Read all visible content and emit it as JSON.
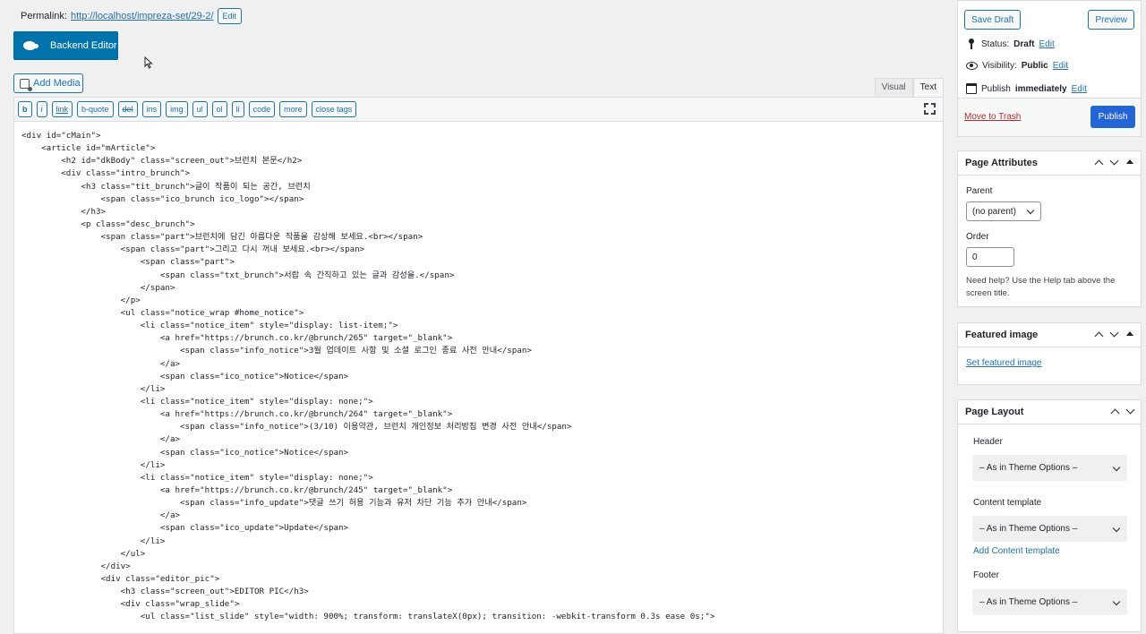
{
  "permalink": {
    "label": "Permalink:",
    "url": "http://localhost/impreza-set/29-2/",
    "edit_label": "Edit"
  },
  "backend_editor": {
    "label": "Backend Editor"
  },
  "add_media": {
    "label": "Add Media"
  },
  "editor_tabs": [
    {
      "label": "Visual",
      "active": false
    },
    {
      "label": "Text",
      "active": true
    }
  ],
  "quicktags": [
    "b",
    "i",
    "link",
    "b-quote",
    "del",
    "ins",
    "img",
    "ul",
    "ol",
    "li",
    "code",
    "more",
    "close tags"
  ],
  "code_lines": [
    "<div id=\"cMain\">",
    "    <article id=\"mArticle\">",
    "        <h2 id=\"dkBody\" class=\"screen_out\">브런치 본문</h2>",
    "        <div class=\"intro_brunch\">",
    "            <h3 class=\"tit_brunch\">글이 작품이 되는 공간, 브런치",
    "                <span class=\"ico_brunch ico_logo\"></span>",
    "            </h3>",
    "            <p class=\"desc_brunch\">",
    "                <span class=\"part\">브런치에 담긴 아름다운 작품을 감상해 보세요.<br></span>",
    "                    <span class=\"part\">그리고 다시 꺼내 보세요.<br></span>",
    "                        <span class=\"part\">",
    "                            <span class=\"txt_brunch\">서랍 속 간직하고 있는 글과 감성을.</span>",
    "                        </span>",
    "                    </p>",
    "                    <ul class=\"notice_wrap #home_notice\">",
    "                        <li class=\"notice_item\" style=\"display: list-item;\">",
    "                            <a href=\"https://brunch.co.kr/@brunch/265\" target=\"_blank\">",
    "                                <span class=\"info_notice\">3월 업데이트 사항 및 소셜 로그인 종료 사전 안내</span>",
    "                            </a>",
    "                            <span class=\"ico_notice\">Notice</span>",
    "                        </li>",
    "                        <li class=\"notice_item\" style=\"display: none;\">",
    "                            <a href=\"https://brunch.co.kr/@brunch/264\" target=\"_blank\">",
    "                                <span class=\"info_notice\">(3/10) 이용약관, 브런치 개인정보 처리방침 변경 사전 안내</span>",
    "                            </a>",
    "                            <span class=\"ico_notice\">Notice</span>",
    "                        </li>",
    "                        <li class=\"notice_item\" style=\"display: none;\">",
    "                            <a href=\"https://brunch.co.kr/@brunch/245\" target=\"_blank\">",
    "                                <span class=\"info_update\">댓글 쓰기 허용 기능과 유저 차단 기능 추가 안내</span>",
    "                            </a>",
    "                            <span class=\"ico_update\">Update</span>",
    "                        </li>",
    "                    </ul>",
    "                </div>",
    "                <div class=\"editor_pic\">",
    "                    <h3 class=\"screen_out\">EDITOR PIC</h3>",
    "                    <div class=\"wrap_slide\">",
    "                        <ul class=\"list_slide\" style=\"width: 900%; transform: translateX(0px); transition: -webkit-transform 0.3s ease 0s;\">"
  ],
  "publish": {
    "save_draft": "Save Draft",
    "preview": "Preview",
    "status_label": "Status:",
    "status_value": "Draft",
    "visibility_label": "Visibility:",
    "visibility_value": "Public",
    "publish_label": "Publish",
    "publish_value": "immediately",
    "edit_label": "Edit",
    "move_to_trash": "Move to Trash",
    "publish_button": "Publish"
  },
  "page_attributes": {
    "title": "Page Attributes",
    "parent_label": "Parent",
    "parent_value": "(no parent)",
    "order_label": "Order",
    "order_value": "0",
    "help": "Need help? Use the Help tab above the screen title."
  },
  "featured_image": {
    "title": "Featured image",
    "link": "Set featured image"
  },
  "page_layout": {
    "title": "Page Layout",
    "header_label": "Header",
    "header_value": "– As in Theme Options –",
    "content_label": "Content template",
    "content_value": "– As in Theme Options –",
    "add_content_template": "Add Content template",
    "footer_label": "Footer",
    "footer_value": "– As in Theme Options –"
  }
}
